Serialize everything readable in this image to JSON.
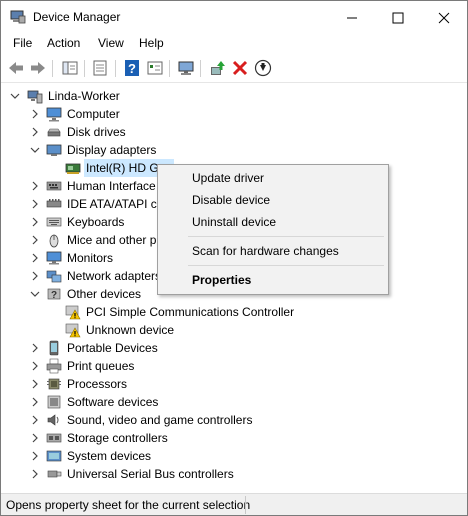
{
  "window": {
    "title": "Device Manager"
  },
  "menu": [
    "File",
    "Action",
    "View",
    "Help"
  ],
  "tree": {
    "root": "Linda-Worker",
    "items": [
      {
        "label": "Computer",
        "icon": "computer-icon",
        "expanded": false
      },
      {
        "label": "Disk drives",
        "icon": "disk-drive-icon",
        "expanded": false
      },
      {
        "label": "Display adapters",
        "icon": "display-adapter-icon",
        "expanded": true,
        "children": [
          {
            "label": "Intel(R) HD Gr...",
            "icon": "display-adapter-icon",
            "selected": true
          }
        ]
      },
      {
        "label": "Human Interface",
        "icon": "hid-icon",
        "expanded": false
      },
      {
        "label": "IDE ATA/ATAPI co",
        "icon": "ide-icon",
        "expanded": false
      },
      {
        "label": "Keyboards",
        "icon": "keyboard-icon",
        "expanded": false
      },
      {
        "label": "Mice and other p",
        "icon": "mouse-icon",
        "expanded": false
      },
      {
        "label": "Monitors",
        "icon": "monitor-icon",
        "expanded": false
      },
      {
        "label": "Network adapters",
        "icon": "network-icon",
        "expanded": false
      },
      {
        "label": "Other devices",
        "icon": "other-devices-icon",
        "expanded": true,
        "children": [
          {
            "label": "PCI Simple Communications Controller",
            "icon": "warning-device-icon"
          },
          {
            "label": "Unknown device",
            "icon": "warning-device-icon"
          }
        ]
      },
      {
        "label": "Portable Devices",
        "icon": "portable-icon",
        "expanded": false
      },
      {
        "label": "Print queues",
        "icon": "printer-icon",
        "expanded": false
      },
      {
        "label": "Processors",
        "icon": "processor-icon",
        "expanded": false
      },
      {
        "label": "Software devices",
        "icon": "software-icon",
        "expanded": false
      },
      {
        "label": "Sound, video and game controllers",
        "icon": "sound-icon",
        "expanded": false
      },
      {
        "label": "Storage controllers",
        "icon": "storage-icon",
        "expanded": false
      },
      {
        "label": "System devices",
        "icon": "system-icon",
        "expanded": false
      },
      {
        "label": "Universal Serial Bus controllers",
        "icon": "usb-icon",
        "expanded": false
      }
    ]
  },
  "context_menu": {
    "update_driver": "Update driver",
    "disable_device": "Disable device",
    "uninstall_device": "Uninstall device",
    "scan": "Scan for hardware changes",
    "properties": "Properties"
  },
  "status": {
    "text": "Opens property sheet for the current selection"
  },
  "colors": {
    "selection": "#cce8ff",
    "remove_red": "#d81e1e",
    "context_bg": "#f2f2f2"
  }
}
